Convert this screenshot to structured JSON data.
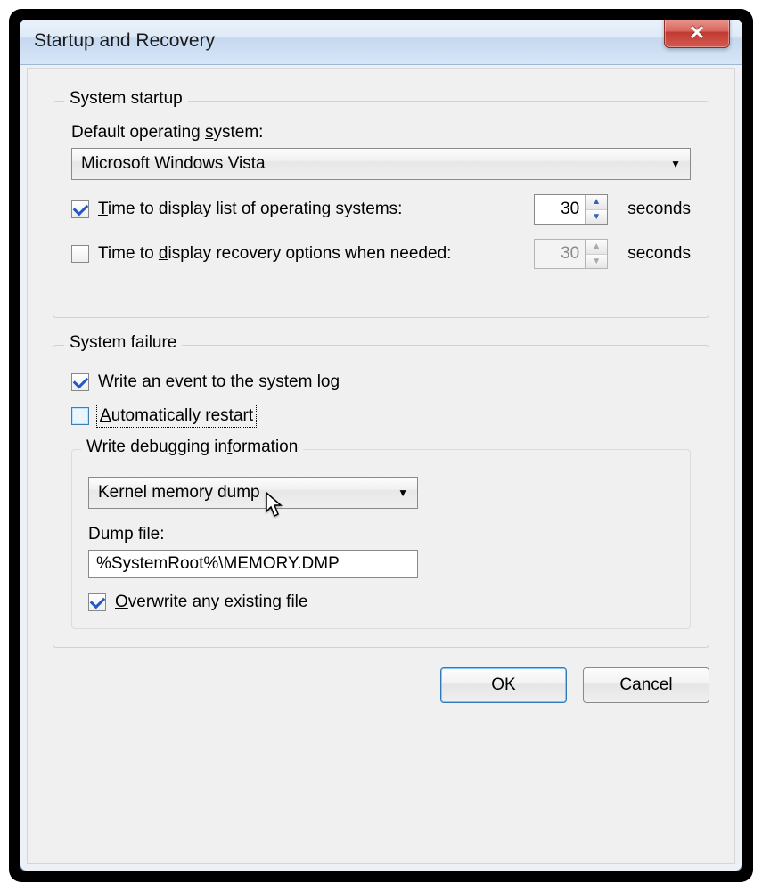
{
  "dialog": {
    "title": "Startup and Recovery"
  },
  "startup": {
    "legend": "System startup",
    "default_os_label_prefix": "Default operating ",
    "default_os_label_key": "s",
    "default_os_label_suffix": "ystem:",
    "default_os_value": "Microsoft Windows Vista",
    "time_list": {
      "checked": true,
      "prefix": "",
      "key": "T",
      "suffix": "ime to display list of operating systems:",
      "value": "30",
      "unit": "seconds"
    },
    "time_recovery": {
      "checked": false,
      "prefix": "Time to ",
      "key": "d",
      "suffix": "isplay recovery options when needed:",
      "value": "30",
      "unit": "seconds"
    }
  },
  "failure": {
    "legend": "System failure",
    "write_event": {
      "checked": true,
      "prefix": "",
      "key": "W",
      "suffix": "rite an event to the system log"
    },
    "auto_restart": {
      "checked": false,
      "prefix": "",
      "key": "A",
      "suffix": "utomatically restart"
    },
    "debug_legend_prefix": "Write debugging in",
    "debug_legend_key": "f",
    "debug_legend_suffix": "ormation",
    "dump_type": "Kernel memory dump",
    "dump_file_label": "Dump file:",
    "dump_file_value": "%SystemRoot%\\MEMORY.DMP",
    "overwrite": {
      "checked": true,
      "prefix": "",
      "key": "O",
      "suffix": "verwrite any existing file"
    }
  },
  "buttons": {
    "ok": "OK",
    "cancel": "Cancel"
  }
}
